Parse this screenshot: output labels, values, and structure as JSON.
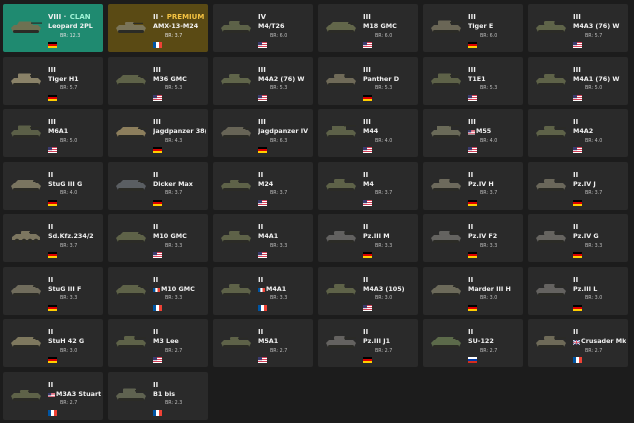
{
  "cards": [
    {
      "tier": "VIII",
      "tag": "CLAN",
      "name": "Leopard 2PL",
      "nation": "de",
      "br": "BR: 12.3",
      "variant": "clan",
      "silhouette": "mbt",
      "color": "#6e7152"
    },
    {
      "tier": "II",
      "tag": "PREMIUM",
      "name": "AMX-13-M24",
      "nation": "fr",
      "br": "BR: 3.7",
      "variant": "premium",
      "silhouette": "light",
      "color": "#7a7458"
    },
    {
      "tier": "IV",
      "tag": "",
      "name": "M4/T26",
      "nation": "us",
      "br": "BR: 6.0",
      "silhouette": "medium",
      "color": "#5d6248"
    },
    {
      "tier": "III",
      "tag": "",
      "name": "M18 GMC",
      "nation": "us",
      "br": "BR: 6.0",
      "silhouette": "td",
      "color": "#62664a"
    },
    {
      "tier": "III",
      "tag": "",
      "name": "Tiger E",
      "nation": "de",
      "br": "BR: 6.0",
      "silhouette": "heavy",
      "color": "#6a6656"
    },
    {
      "tier": "III",
      "tag": "",
      "name": "M4A3 (76) W",
      "nation": "us",
      "br": "BR: 5.7",
      "silhouette": "medium",
      "color": "#5f6449"
    },
    {
      "tier": "III",
      "tag": "",
      "name": "Tiger H1",
      "nation": "de",
      "br": "BR: 5.7",
      "silhouette": "heavy",
      "color": "#8a8268"
    },
    {
      "tier": "III",
      "tag": "",
      "name": "M36 GMC",
      "nation": "us",
      "br": "BR: 5.3",
      "silhouette": "td",
      "color": "#5e6248"
    },
    {
      "tier": "III",
      "tag": "",
      "name": "M4A2 (76) W",
      "nation": "us",
      "br": "BR: 5.3",
      "silhouette": "medium",
      "color": "#60654a"
    },
    {
      "tier": "III",
      "tag": "",
      "name": "Panther D",
      "nation": "de",
      "br": "BR: 5.3",
      "silhouette": "medium",
      "color": "#6f6a58"
    },
    {
      "tier": "III",
      "tag": "",
      "name": "T1E1",
      "nation": "us",
      "br": "BR: 5.3",
      "silhouette": "heavy",
      "color": "#5e6248"
    },
    {
      "tier": "III",
      "tag": "",
      "name": "M4A1 (76) W",
      "nation": "us",
      "br": "BR: 5.0",
      "silhouette": "medium",
      "color": "#5e6248"
    },
    {
      "tier": "III",
      "tag": "",
      "name": "M6A1",
      "nation": "us",
      "br": "BR: 5.0",
      "silhouette": "heavy",
      "color": "#5b5f47"
    },
    {
      "tier": "III",
      "tag": "",
      "name": "Jagdpanzer 38(t)",
      "nation": "de",
      "br": "BR: 4.3",
      "silhouette": "td",
      "color": "#8c7e5c"
    },
    {
      "tier": "III",
      "tag": "",
      "name": "Jagdpanzer IV",
      "nation": "de",
      "br": "BR: 6.3",
      "silhouette": "td",
      "color": "#676456"
    },
    {
      "tier": "III",
      "tag": "",
      "name": "M44",
      "nation": "us",
      "br": "BR: 4.0",
      "silhouette": "spg",
      "color": "#5d6148"
    },
    {
      "tier": "III",
      "tag": "",
      "name": "M55",
      "nation": "us",
      "br": "BR: 4.0",
      "silhouette": "spg",
      "color": "#6a6a58",
      "nameFlag": "us"
    },
    {
      "tier": "II",
      "tag": "",
      "name": "M4A2",
      "nation": "us",
      "br": "BR: 4.0",
      "silhouette": "medium",
      "color": "#5e6248"
    },
    {
      "tier": "II",
      "tag": "",
      "name": "StuG III G",
      "nation": "de",
      "br": "BR: 4.0",
      "silhouette": "td",
      "color": "#7a7560"
    },
    {
      "tier": "II",
      "tag": "",
      "name": "Dicker Max",
      "nation": "de",
      "br": "BR: 3.7",
      "silhouette": "td",
      "color": "#5a5e62"
    },
    {
      "tier": "II",
      "tag": "",
      "name": "M24",
      "nation": "us",
      "br": "BR: 3.7",
      "silhouette": "light",
      "color": "#5e6248"
    },
    {
      "tier": "II",
      "tag": "",
      "name": "M4",
      "nation": "us",
      "br": "BR: 3.7",
      "silhouette": "medium",
      "color": "#5e6248"
    },
    {
      "tier": "II",
      "tag": "",
      "name": "Pz.IV H",
      "nation": "de",
      "br": "BR: 3.7",
      "silhouette": "medium",
      "color": "#6d6a5c"
    },
    {
      "tier": "II",
      "tag": "",
      "name": "Pz.IV J",
      "nation": "de",
      "br": "BR: 3.7",
      "silhouette": "medium",
      "color": "#6a675a"
    },
    {
      "tier": "II",
      "tag": "",
      "name": "Sd.Kfz.234/2",
      "nation": "de",
      "br": "BR: 3.7",
      "silhouette": "car",
      "color": "#7c7660"
    },
    {
      "tier": "II",
      "tag": "",
      "name": "M10 GMC",
      "nation": "us",
      "br": "BR: 3.3",
      "silhouette": "td",
      "color": "#5e6248"
    },
    {
      "tier": "II",
      "tag": "",
      "name": "M4A1",
      "nation": "us",
      "br": "BR: 3.3",
      "silhouette": "medium",
      "color": "#5e6248"
    },
    {
      "tier": "II",
      "tag": "",
      "name": "Pz.III M",
      "nation": "de",
      "br": "BR: 3.3",
      "silhouette": "medium",
      "color": "#626160"
    },
    {
      "tier": "II",
      "tag": "",
      "name": "Pz.IV F2",
      "nation": "de",
      "br": "BR: 3.3",
      "silhouette": "medium",
      "color": "#646360"
    },
    {
      "tier": "II",
      "tag": "",
      "name": "Pz.IV G",
      "nation": "de",
      "br": "BR: 3.3",
      "silhouette": "medium",
      "color": "#666460"
    },
    {
      "tier": "II",
      "tag": "",
      "name": "StuG III F",
      "nation": "de",
      "br": "BR: 3.3",
      "silhouette": "td",
      "color": "#706c5c"
    },
    {
      "tier": "II",
      "tag": "",
      "name": "M10 GMC",
      "nation": "fr",
      "br": "BR: 3.3",
      "silhouette": "td",
      "color": "#5e6248",
      "nameFlag": "fr"
    },
    {
      "tier": "II",
      "tag": "",
      "name": "M4A1",
      "nation": "fr",
      "br": "BR: 3.3",
      "silhouette": "medium",
      "color": "#5e6248",
      "nameFlag": "fr"
    },
    {
      "tier": "II",
      "tag": "",
      "name": "M4A3 (105)",
      "nation": "us",
      "br": "BR: 3.0",
      "silhouette": "medium",
      "color": "#5e6248"
    },
    {
      "tier": "II",
      "tag": "",
      "name": "Marder III H",
      "nation": "de",
      "br": "BR: 3.0",
      "silhouette": "td",
      "color": "#6c6a5a"
    },
    {
      "tier": "II",
      "tag": "",
      "name": "Pz.III L",
      "nation": "de",
      "br": "BR: 3.0",
      "silhouette": "medium",
      "color": "#646260"
    },
    {
      "tier": "II",
      "tag": "",
      "name": "StuH 42 G",
      "nation": "de",
      "br": "BR: 3.0",
      "silhouette": "td",
      "color": "#7e785e"
    },
    {
      "tier": "II",
      "tag": "",
      "name": "M3 Lee",
      "nation": "us",
      "br": "BR: 2.7",
      "silhouette": "medium",
      "color": "#5e6248"
    },
    {
      "tier": "II",
      "tag": "",
      "name": "M5A1",
      "nation": "us",
      "br": "BR: 2.7",
      "silhouette": "light",
      "color": "#5e6248"
    },
    {
      "tier": "II",
      "tag": "",
      "name": "Pz.III J1",
      "nation": "de",
      "br": "BR: 2.7",
      "silhouette": "medium",
      "color": "#646260"
    },
    {
      "tier": "II",
      "tag": "",
      "name": "SU-122",
      "nation": "ru",
      "br": "BR: 2.7",
      "silhouette": "td",
      "color": "#5c6a4a"
    },
    {
      "tier": "II",
      "tag": "",
      "name": "Crusader Mk.II",
      "nation": "fr",
      "br": "BR: 2.7",
      "silhouette": "medium",
      "color": "#6e6a58",
      "nameFlag": "uk"
    },
    {
      "tier": "II",
      "tag": "",
      "name": "M3A3 Stuart",
      "nation": "fr",
      "br": "BR: 2.7",
      "silhouette": "light",
      "color": "#5e6248",
      "nameFlag": "us"
    },
    {
      "tier": "II",
      "tag": "",
      "name": "B1 bis",
      "nation": "fr",
      "br": "BR: 2.3",
      "silhouette": "heavy",
      "color": "#5f6250"
    }
  ]
}
